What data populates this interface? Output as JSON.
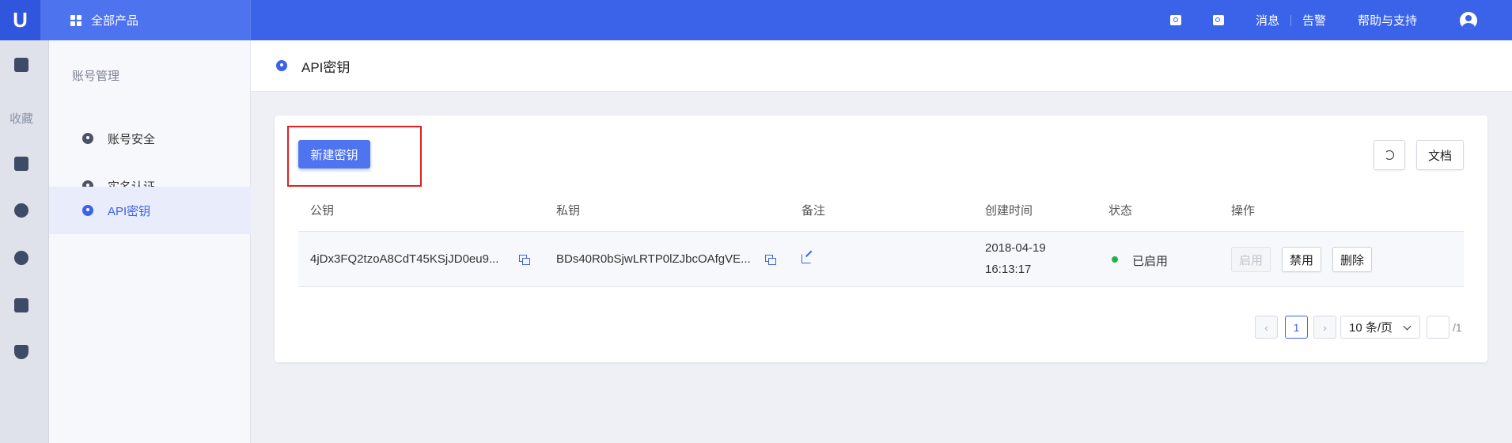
{
  "topbar": {
    "logo": "U",
    "products_label": "全部产品",
    "messages": "消息",
    "alerts": "告警",
    "help": "帮助与支持"
  },
  "rail": {
    "favorites": "收藏"
  },
  "sidebar": {
    "heading": "账号管理",
    "items": [
      {
        "label": "账号安全"
      },
      {
        "label": "实名认证"
      },
      {
        "label": "API密钥"
      }
    ]
  },
  "page": {
    "title": "API密钥"
  },
  "toolbar": {
    "new_key": "新建密钥",
    "docs": "文档"
  },
  "table": {
    "columns": [
      "公钥",
      "私钥",
      "备注",
      "创建时间",
      "状态",
      "操作"
    ],
    "rows": [
      {
        "public_key": "4jDx3FQ2tzoA8CdT45KSjJD0eu9...",
        "private_key": "BDs40R0bSjwLRTP0lZJbcOAfgVE...",
        "created_date": "2018-04-19",
        "created_time": "16:13:17",
        "status": "已启用",
        "actions": [
          "启用",
          "禁用",
          "删除"
        ]
      }
    ]
  },
  "pagination": {
    "prev": "‹",
    "current": "1",
    "next": "›",
    "page_size": "10 条/页",
    "total": "/1"
  },
  "colors": {
    "primary": "#3b63ea",
    "status_enabled": "#21b34a",
    "highlight": "#e02020"
  }
}
